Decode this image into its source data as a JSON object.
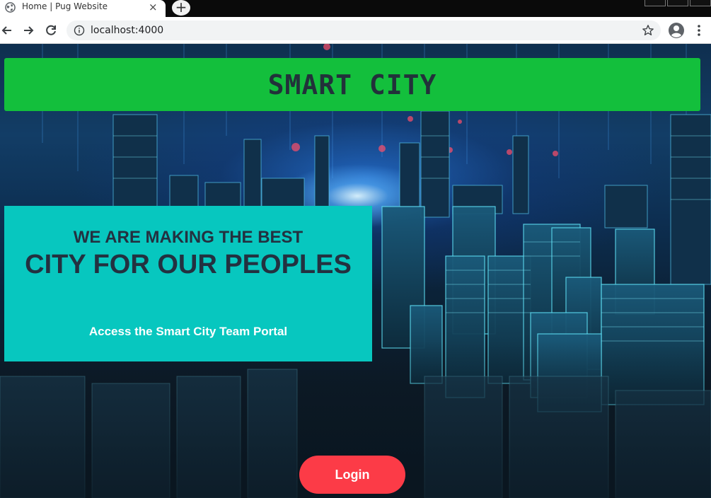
{
  "browser": {
    "tab_title": "Home | Pug Website",
    "tab_close": "×",
    "new_tab": "+",
    "url": "localhost:4000",
    "icons": {
      "favicon": "globe-icon",
      "back": "back-arrow-icon",
      "forward": "forward-arrow-icon",
      "reload": "reload-icon",
      "info": "info-icon",
      "bookmark": "star-icon",
      "account": "account-icon",
      "menu": "kebab-menu-icon"
    }
  },
  "header": {
    "title": "SMART CITY",
    "background": "#13bf3c"
  },
  "hero": {
    "line1": "WE ARE MAKING THE BEST",
    "line2": "CITY FOR OUR PEOPLES",
    "subtitle": "Access the Smart City Team Portal",
    "background": "#07c7bf"
  },
  "login": {
    "label": "Login",
    "color": "#fc3b47"
  }
}
